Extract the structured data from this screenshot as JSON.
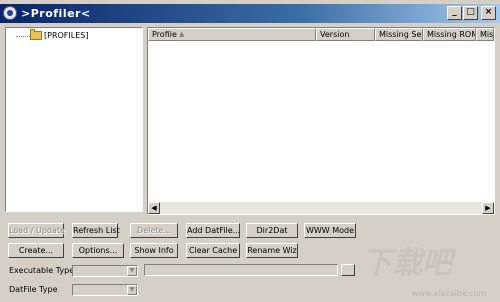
{
  "window": {
    "title": ">Profiler<"
  },
  "titlebar_buttons": {
    "minimize": "_",
    "maximize": "□",
    "close": "×"
  },
  "tree": {
    "root_label": "[PROFILES]"
  },
  "list": {
    "columns": [
      "Profile",
      "Version",
      "Missing Sets",
      "Missing ROMs",
      "Mis"
    ],
    "sort_indicator": "▲",
    "rows": []
  },
  "scroll": {
    "left": "◀",
    "right": "▶"
  },
  "buttons": {
    "load_update": "Load / Update",
    "refresh_list": "Refresh List",
    "delete": "Delete...",
    "add_datfile": "Add DatFile...",
    "dir2dat": "Dir2Dat",
    "www_mode": "WWW Mode",
    "create": "Create...",
    "options": "Options...",
    "show_info": "Show Info",
    "clear_cache": "Clear Cache",
    "rename_wiz": "Rename Wiz"
  },
  "fields": {
    "executable_type_label": "Executable Type",
    "datfile_type_label": "DatFile Type",
    "executable_type_value": "",
    "datfile_type_value": "",
    "combo_arrow": "▼"
  },
  "watermark": {
    "text": "下载吧",
    "url": "www.xiazaiba.com"
  }
}
